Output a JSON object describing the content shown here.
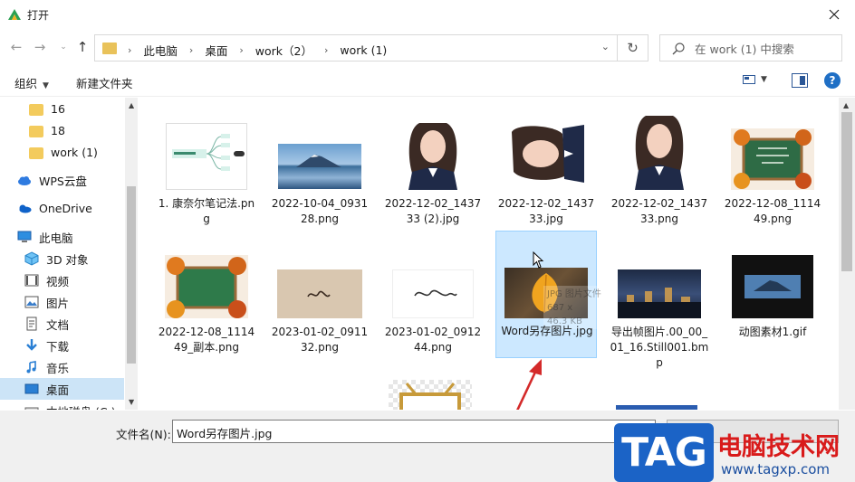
{
  "window": {
    "title": "打开"
  },
  "address": {
    "crumbs": [
      "此电脑",
      "桌面",
      "work（2）",
      "work (1)"
    ],
    "search_placeholder": "在 work (1) 中搜索"
  },
  "toolbar": {
    "organize_label": "组织",
    "new_folder_label": "新建文件夹"
  },
  "sidebar": {
    "items": [
      {
        "label": "16",
        "icon": "folder-icon"
      },
      {
        "label": "18",
        "icon": "folder-icon"
      },
      {
        "label": "work (1)",
        "icon": "folder-icon"
      },
      {
        "label": "WPS云盘",
        "icon": "cloud-icon"
      },
      {
        "label": "OneDrive",
        "icon": "onedrive-icon"
      },
      {
        "label": "此电脑",
        "icon": "computer-icon"
      },
      {
        "label": "3D 对象",
        "icon": "cube-icon"
      },
      {
        "label": "视频",
        "icon": "video-icon"
      },
      {
        "label": "图片",
        "icon": "picture-icon"
      },
      {
        "label": "文档",
        "icon": "document-icon"
      },
      {
        "label": "下载",
        "icon": "download-icon"
      },
      {
        "label": "音乐",
        "icon": "music-icon"
      },
      {
        "label": "桌面",
        "icon": "desktop-icon",
        "selected": true
      },
      {
        "label": "本地磁盘 (C:)",
        "icon": "drive-icon"
      }
    ]
  },
  "files": [
    {
      "name": "1. 康奈尔笔记法.png",
      "kind": "mindmap"
    },
    {
      "name": "2022-10-04_093128.png",
      "kind": "landscape"
    },
    {
      "name": "2022-12-02_143733 (2).jpg",
      "kind": "portrait"
    },
    {
      "name": "2022-12-02_143733.jpg",
      "kind": "portrait-rotated"
    },
    {
      "name": "2022-12-02_143733.png",
      "kind": "portrait"
    },
    {
      "name": "2022-12-08_111449.png",
      "kind": "chalkboard-text"
    },
    {
      "name": "2022-12-08_111449_副本.png",
      "kind": "chalkboard"
    },
    {
      "name": "2023-01-02_091132.png",
      "kind": "handwriting-brown"
    },
    {
      "name": "2023-01-02_091244.png",
      "kind": "handwriting-white"
    },
    {
      "name": "Word另存图片.jpg",
      "kind": "autumn-leaf",
      "selected": true
    },
    {
      "name": "导出帧图片.00_00_01_16.Still001.bmp",
      "kind": "city-night"
    },
    {
      "name": "动图素材1.gif",
      "kind": "mountain-dark"
    }
  ],
  "drag_tooltip": {
    "type": "JPG 图片文件",
    "dims": "687 x",
    "size": "46.3 KB"
  },
  "bottom": {
    "filename_label": "文件名(N):",
    "filename_value": "Word另存图片.jpg"
  },
  "watermark": {
    "logo": "TAG",
    "title": "电脑技术网",
    "url": "www.tagxp.com"
  },
  "colors": {
    "selection": "#cce8ff",
    "selection_border": "#99d1ff",
    "arrow": "#d42a2a",
    "accent": "#1f6fc5"
  }
}
